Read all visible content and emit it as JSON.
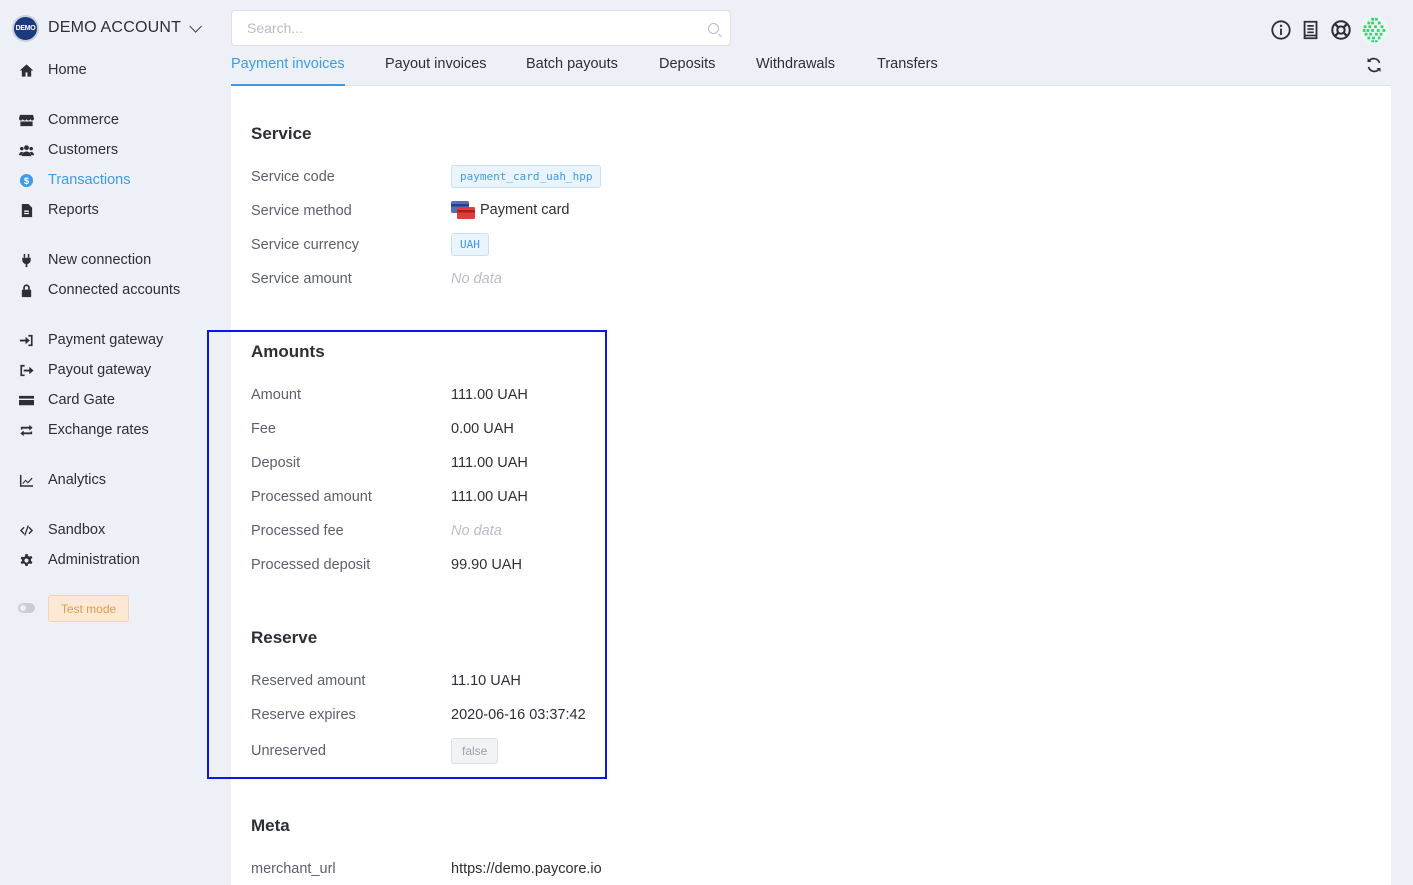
{
  "account": {
    "logo_text": "DEMO",
    "name": "DEMO ACCOUNT"
  },
  "search": {
    "placeholder": "Search...",
    "value": ""
  },
  "sidebar": {
    "items": [
      {
        "label": "Home",
        "icon": "home-icon"
      },
      {
        "label": "Commerce",
        "icon": "store-icon"
      },
      {
        "label": "Customers",
        "icon": "users-icon"
      },
      {
        "label": "Transactions",
        "icon": "dollar-circle-icon",
        "active": true
      },
      {
        "label": "Reports",
        "icon": "file-icon"
      },
      {
        "label": "New connection",
        "icon": "plug-icon"
      },
      {
        "label": "Connected accounts",
        "icon": "lock-icon"
      },
      {
        "label": "Payment gateway",
        "icon": "sign-in-icon"
      },
      {
        "label": "Payout gateway",
        "icon": "sign-out-icon"
      },
      {
        "label": "Card Gate",
        "icon": "credit-card-icon"
      },
      {
        "label": "Exchange rates",
        "icon": "exchange-icon"
      },
      {
        "label": "Analytics",
        "icon": "chart-line-icon"
      },
      {
        "label": "Sandbox",
        "icon": "code-icon"
      },
      {
        "label": "Administration",
        "icon": "gear-icon"
      }
    ],
    "test_mode": "Test mode"
  },
  "tabs": [
    {
      "label": "Payment invoices",
      "active": true
    },
    {
      "label": "Payout invoices"
    },
    {
      "label": "Batch payouts"
    },
    {
      "label": "Deposits"
    },
    {
      "label": "Withdrawals"
    },
    {
      "label": "Transfers"
    }
  ],
  "service": {
    "title": "Service",
    "code_label": "Service code",
    "code_value": "payment_card_uah_hpp",
    "method_label": "Service method",
    "method_value": "Payment card",
    "currency_label": "Service currency",
    "currency_value": "UAH",
    "amount_label": "Service amount",
    "amount_value": "No data"
  },
  "amounts": {
    "title": "Amounts",
    "rows": [
      {
        "label": "Amount",
        "value": "111.00 UAH"
      },
      {
        "label": "Fee",
        "value": "0.00 UAH"
      },
      {
        "label": "Deposit",
        "value": "111.00 UAH"
      },
      {
        "label": "Processed amount",
        "value": "111.00 UAH"
      },
      {
        "label": "Processed fee",
        "value": "No data"
      },
      {
        "label": "Processed deposit",
        "value": "99.90 UAH"
      }
    ]
  },
  "reserve": {
    "title": "Reserve",
    "reserved_label": "Reserved amount",
    "reserved_value": "11.10 UAH",
    "expires_label": "Reserve expires",
    "expires_value": "2020-06-16 03:37:42",
    "unreserved_label": "Unreserved",
    "unreserved_value": "false"
  },
  "meta": {
    "title": "Meta",
    "merchant_url_label": "merchant_url",
    "merchant_url_value": "https://demo.paycore.io"
  },
  "colors": {
    "accent": "#3d9be9",
    "highlight": "#0a17e6",
    "test_mode": "#e69a4b"
  }
}
